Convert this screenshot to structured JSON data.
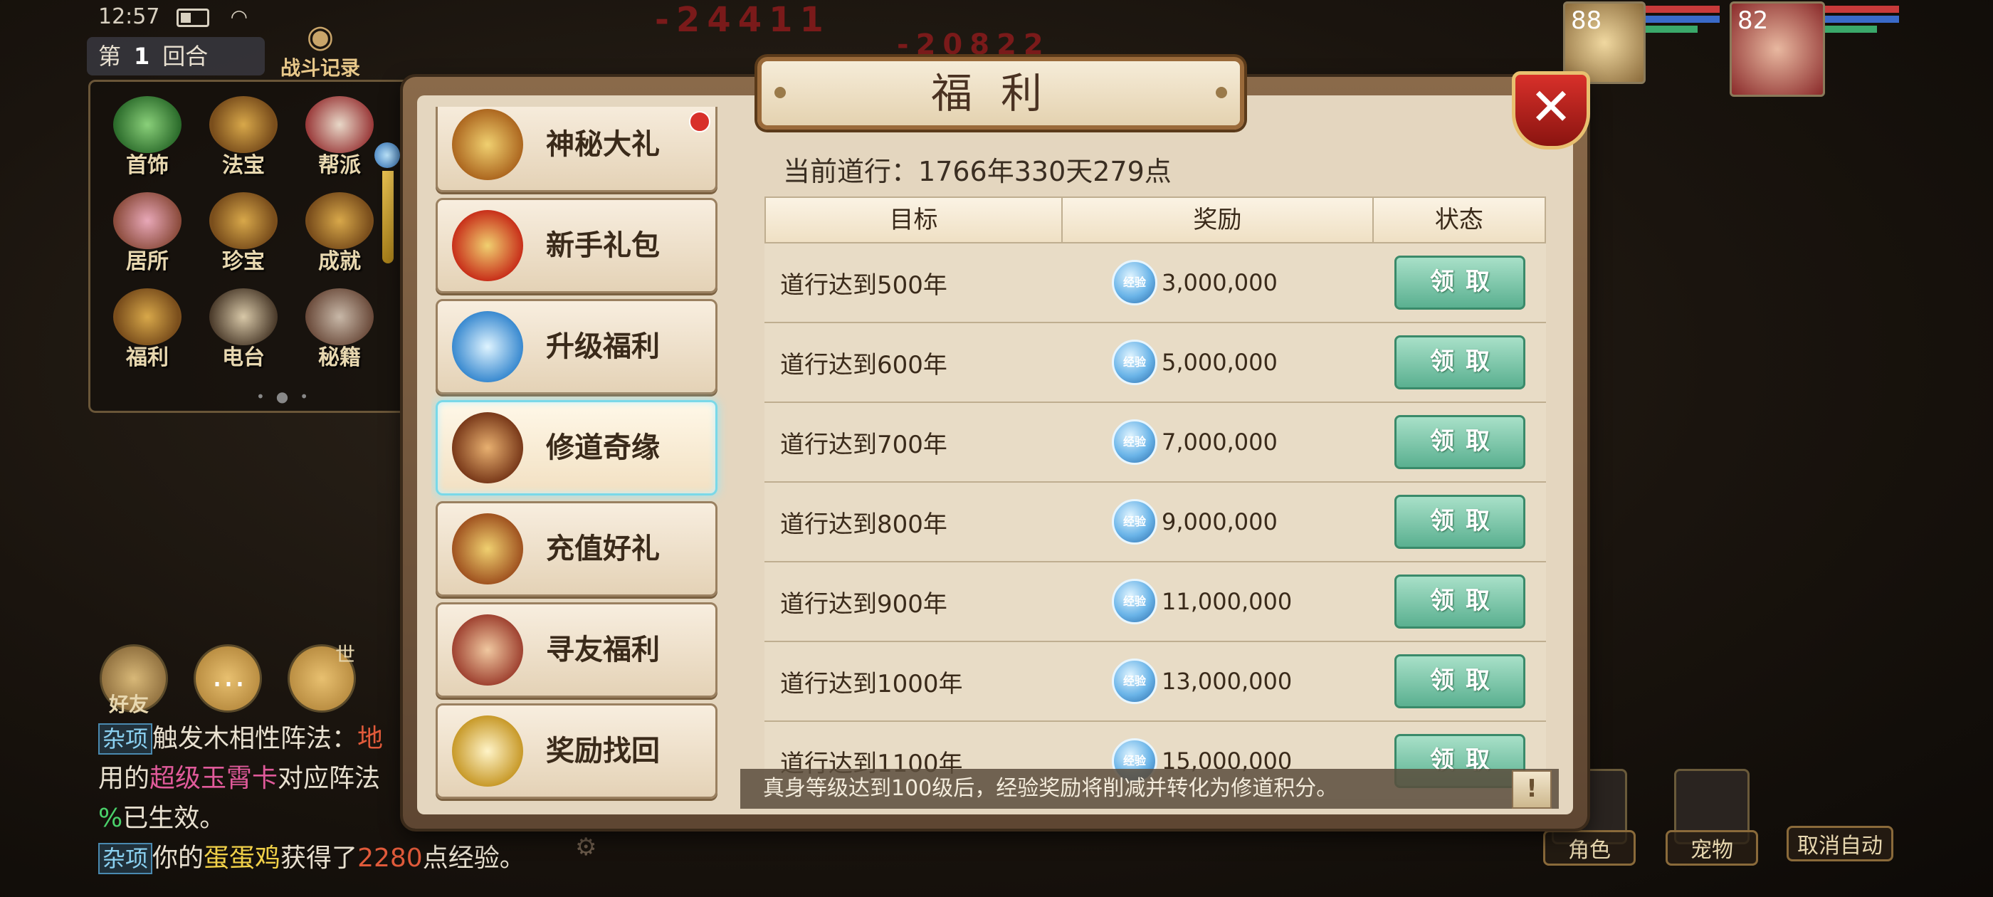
{
  "statusbar": {
    "time": "12:57"
  },
  "hud": {
    "round_prefix": "第",
    "round_number": "1",
    "round_suffix": "回合",
    "battle_log": "战斗记录",
    "damage_numbers": [
      "-24411",
      "-20822"
    ],
    "icons": [
      {
        "label": "首饰",
        "icon": "necklace-icon"
      },
      {
        "label": "法宝",
        "icon": "gourd-icon"
      },
      {
        "label": "帮派",
        "icon": "clan-icon"
      },
      {
        "label": "居所",
        "icon": "house-icon"
      },
      {
        "label": "珍宝",
        "icon": "treasure-bag-icon"
      },
      {
        "label": "成就",
        "icon": "achievement-icon"
      },
      {
        "label": "福利",
        "icon": "gift-chest-icon"
      },
      {
        "label": "电台",
        "icon": "gramophone-icon"
      },
      {
        "label": "秘籍",
        "icon": "book-icon"
      }
    ],
    "party": [
      {
        "level": "88"
      },
      {
        "level": "82"
      }
    ],
    "bottom_left": [
      {
        "label": "好友"
      }
    ],
    "voice_badge": "世",
    "right_buttons": [
      {
        "label": "角色"
      },
      {
        "label": "宠物"
      },
      {
        "label": "取消自动"
      }
    ]
  },
  "chat": {
    "line1_tag": "杂项",
    "line1_text": "触发木相性阵法：",
    "line1_cont": "地",
    "line2_prefix": "用的",
    "line2_highlight": "超级玉霄卡",
    "line2_suffix": "对应阵法",
    "line3_pct": "%",
    "line3_text": "已生效。",
    "line4_tag": "杂项",
    "line4_pre": "你的",
    "line4_pet": "蛋蛋鸡",
    "line4_mid": "获得了",
    "line4_num": "2280",
    "line4_suf": "点经验。"
  },
  "dialog": {
    "title": "福利",
    "current_dao_label": "当前道行：",
    "current_dao_value": "1766年330天279点",
    "columns": [
      "目标",
      "奖励",
      "状态"
    ],
    "exp_badge_text": "经验",
    "claim_label": "领取",
    "rows": [
      {
        "goal": "道行达到500年",
        "reward": "3,000,000"
      },
      {
        "goal": "道行达到600年",
        "reward": "5,000,000"
      },
      {
        "goal": "道行达到700年",
        "reward": "7,000,000"
      },
      {
        "goal": "道行达到800年",
        "reward": "9,000,000"
      },
      {
        "goal": "道行达到900年",
        "reward": "11,000,000"
      },
      {
        "goal": "道行达到1000年",
        "reward": "13,000,000"
      },
      {
        "goal": "道行达到1100年",
        "reward": "15,000,000"
      }
    ],
    "notice": "真身等级达到100级后，经验奖励将削减并转化为修道积分。",
    "info_label": "!",
    "menu": [
      {
        "label": "神秘大礼",
        "icon": "treasure-chest-icon"
      },
      {
        "label": "新手礼包",
        "icon": "gift-box-icon"
      },
      {
        "label": "升级福利",
        "icon": "exp-up-icon"
      },
      {
        "label": "修道奇缘",
        "icon": "cultivation-icon",
        "active": true
      },
      {
        "label": "充值好礼",
        "icon": "recharge-chest-icon"
      },
      {
        "label": "寻友福利",
        "icon": "handshake-icon"
      },
      {
        "label": "奖励找回",
        "icon": "yin-yang-icon"
      }
    ]
  },
  "colors": {
    "accent": "#5ab090",
    "active_border": "#7ad8e8",
    "close": "#d8302a"
  }
}
